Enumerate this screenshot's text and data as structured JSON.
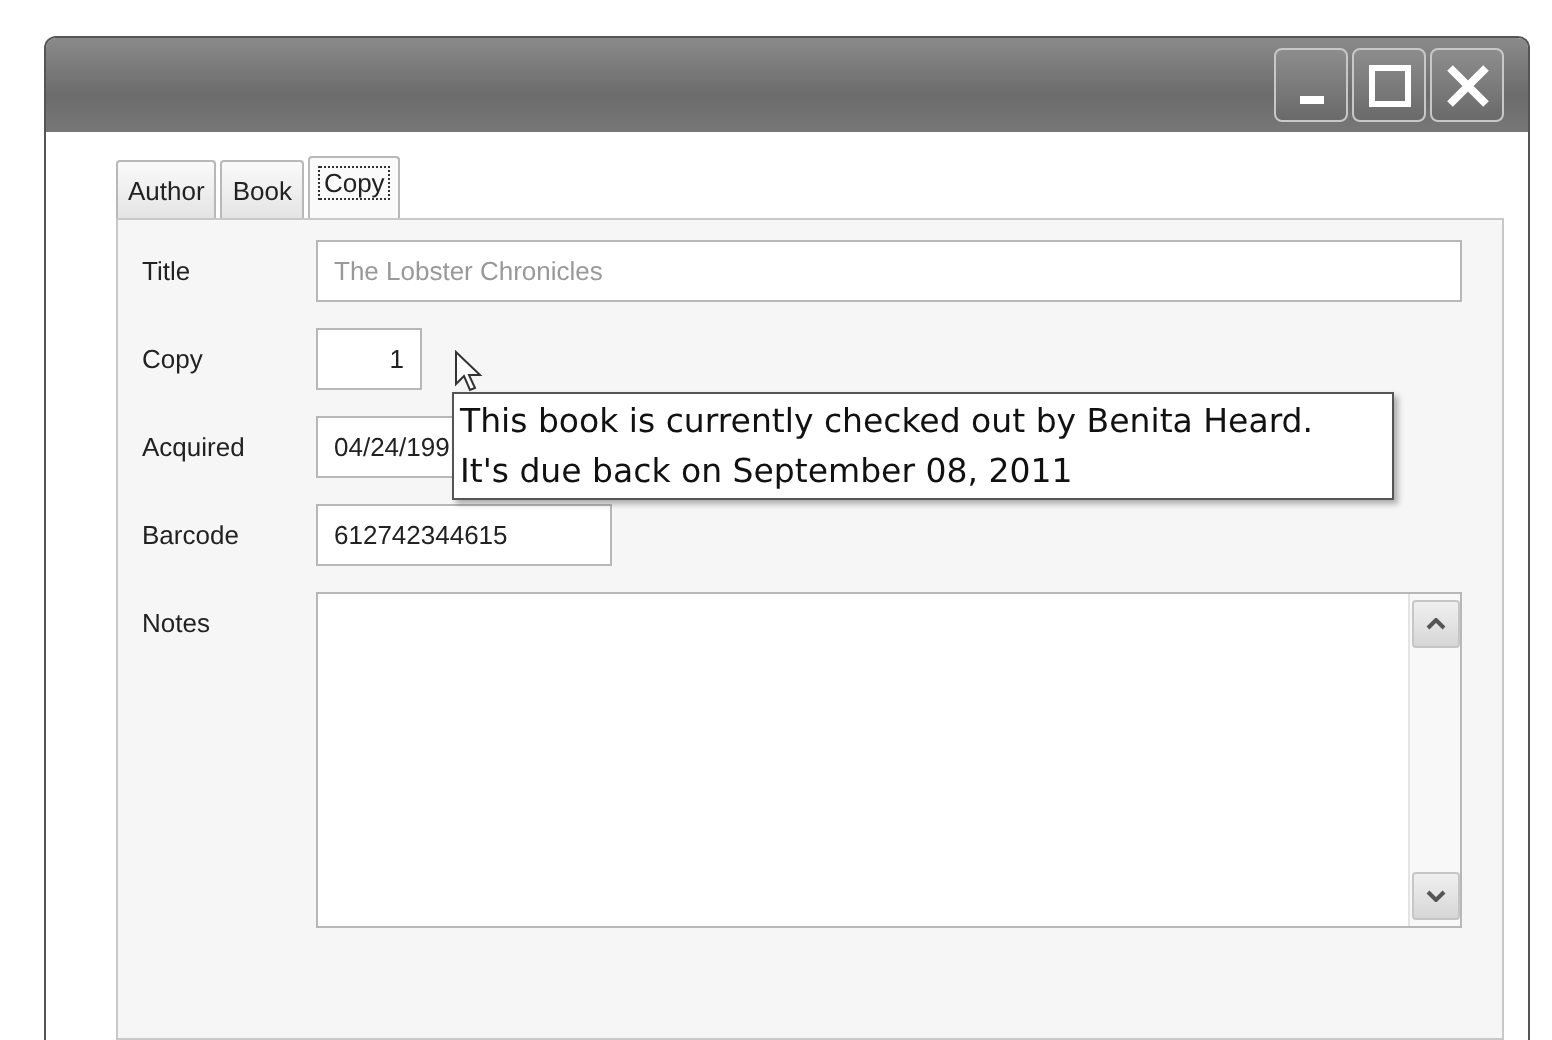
{
  "tabs": [
    {
      "label": "Author",
      "selected": false
    },
    {
      "label": "Book",
      "selected": false
    },
    {
      "label": "Copy",
      "selected": true
    }
  ],
  "fields": [
    {
      "label": "Title",
      "kind": "wide",
      "value": "The Lobster Chronicles",
      "disabled": true
    },
    {
      "label": "Copy",
      "kind": "short",
      "value": "1",
      "disabled": false
    },
    {
      "label": "Acquired",
      "kind": "medium",
      "value": "04/24/199",
      "disabled": false
    },
    {
      "label": "Barcode",
      "kind": "medium",
      "value": "612742344615",
      "disabled": false
    },
    {
      "label": "Notes",
      "kind": "notes",
      "disabled": false
    }
  ],
  "tooltip": {
    "lines": [
      "This book is currently checked out by Benita Heard.",
      "It's due back on September 08, 2011"
    ]
  }
}
